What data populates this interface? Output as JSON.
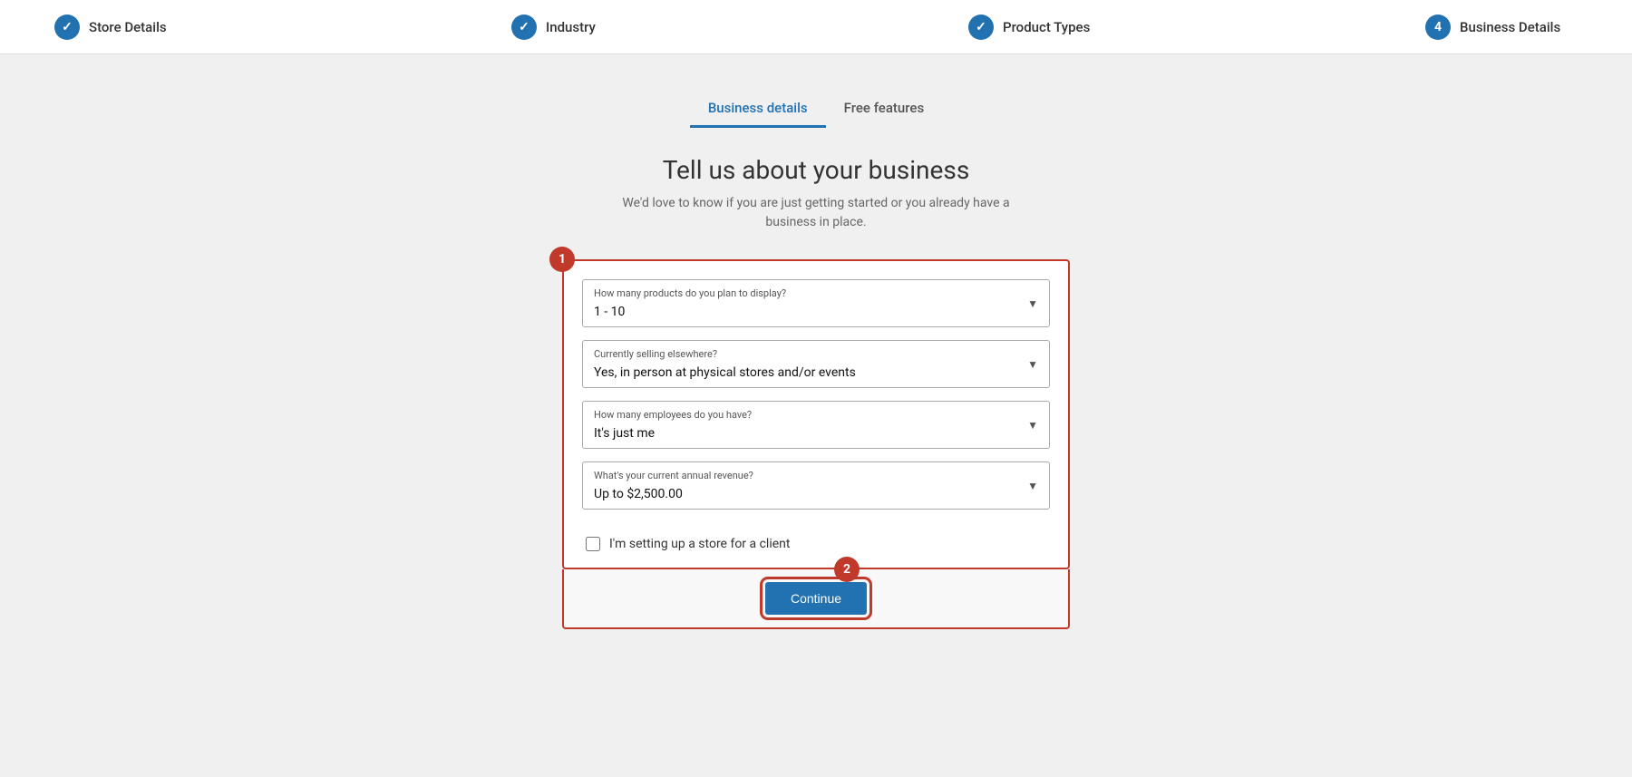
{
  "progress": {
    "steps": [
      {
        "id": "store-details",
        "label": "Store Details",
        "type": "completed",
        "icon": "✓"
      },
      {
        "id": "industry",
        "label": "Industry",
        "type": "completed",
        "icon": "✓"
      },
      {
        "id": "product-types",
        "label": "Product Types",
        "type": "completed",
        "icon": "✓"
      },
      {
        "id": "business-details",
        "label": "Business Details",
        "type": "numbered",
        "icon": "4"
      }
    ]
  },
  "tabs": [
    {
      "id": "business-details",
      "label": "Business details",
      "active": true
    },
    {
      "id": "free-features",
      "label": "Free features",
      "active": false
    }
  ],
  "heading": "Tell us about your business",
  "subheading": "We'd love to know if you are just getting started or you already have a business in place.",
  "badge1": "1",
  "badge2": "2",
  "form": {
    "fields": [
      {
        "id": "products-count",
        "label": "How many products do you plan to display?",
        "value": "1 - 10"
      },
      {
        "id": "selling-elsewhere",
        "label": "Currently selling elsewhere?",
        "value": "Yes, in person at physical stores and/or events"
      },
      {
        "id": "employees",
        "label": "How many employees do you have?",
        "value": "It's just me"
      },
      {
        "id": "revenue",
        "label": "What's your current annual revenue?",
        "value": "Up to $2,500.00"
      }
    ],
    "checkbox": {
      "label": "I'm setting up a store for a client",
      "checked": false
    }
  },
  "continue_button": "Continue"
}
